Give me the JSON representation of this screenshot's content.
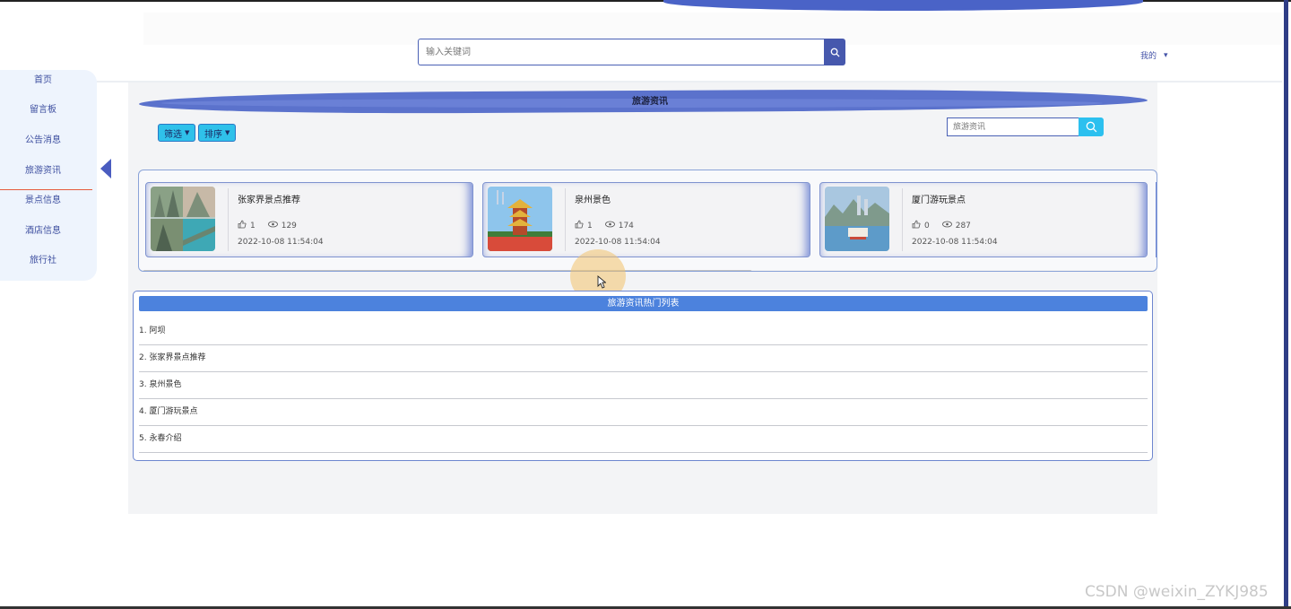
{
  "header": {
    "search_placeholder": "输入关键词",
    "user_menu_label": "我的",
    "user_menu_caret": "▾"
  },
  "sidebar": {
    "items": [
      {
        "label": "首页"
      },
      {
        "label": "留言板"
      },
      {
        "label": "公告消息"
      },
      {
        "label": "旅游资讯"
      },
      {
        "label": "景点信息"
      },
      {
        "label": "酒店信息"
      },
      {
        "label": "旅行社"
      }
    ]
  },
  "main": {
    "title": "旅游资讯",
    "filter_button": "筛选",
    "sort_button": "排序",
    "search_placeholder": "旅游资讯"
  },
  "cards": [
    {
      "title": "张家界景点推荐",
      "likes": "1",
      "views": "129",
      "date": "2022-10-08 11:54:04"
    },
    {
      "title": "泉州景色",
      "likes": "1",
      "views": "174",
      "date": "2022-10-08 11:54:04"
    },
    {
      "title": "厦门游玩景点",
      "likes": "0",
      "views": "287",
      "date": "2022-10-08 11:54:04"
    }
  ],
  "hot_list": {
    "header": "旅游资讯热门列表",
    "items": [
      {
        "label": "1. 阿坝"
      },
      {
        "label": "2. 张家界景点推荐"
      },
      {
        "label": "3. 泉州景色"
      },
      {
        "label": "4. 厦门游玩景点"
      },
      {
        "label": "5. 永春介绍"
      }
    ]
  },
  "watermark": "CSDN @weixin_ZYKJ985",
  "colors": {
    "accent": "#4658ad",
    "button_cyan": "#2fc1ea",
    "hot_header": "#4c82dd",
    "sidebar_bg": "#eef4fd"
  }
}
